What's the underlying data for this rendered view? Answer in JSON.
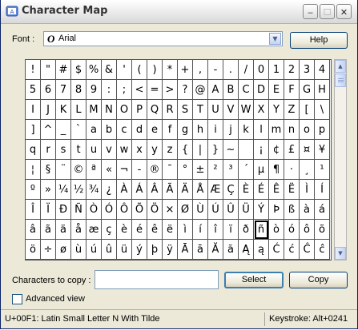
{
  "window": {
    "title": "Character Map",
    "icons": {
      "app": "character-map-icon",
      "minimize": "minimize-icon",
      "maximize": "maximize-icon",
      "close": "close-icon"
    },
    "controls": {
      "minimize": "‒",
      "maximize": "☐",
      "close": "✕"
    }
  },
  "font": {
    "label": "Font :",
    "value": "Arial",
    "type_glyph": "O",
    "dropdown_arrow": "▼"
  },
  "buttons": {
    "help": "Help",
    "select": "Select",
    "copy": "Copy"
  },
  "grid": {
    "columns": 20,
    "rows": [
      [
        "!",
        "\"",
        "#",
        "$",
        "%",
        "&",
        "'",
        "(",
        ")",
        "*",
        "+",
        ",",
        "-",
        ".",
        "/",
        "0",
        "1",
        "2",
        "3",
        "4"
      ],
      [
        "5",
        "6",
        "7",
        "8",
        "9",
        ":",
        ";",
        "<",
        "=",
        ">",
        "?",
        "@",
        "A",
        "B",
        "C",
        "D",
        "E",
        "F",
        "G",
        "H"
      ],
      [
        "I",
        "J",
        "K",
        "L",
        "M",
        "N",
        "O",
        "P",
        "Q",
        "R",
        "S",
        "T",
        "U",
        "V",
        "W",
        "X",
        "Y",
        "Z",
        "[",
        "\\"
      ],
      [
        "]",
        "^",
        "_",
        "`",
        "a",
        "b",
        "c",
        "d",
        "e",
        "f",
        "g",
        "h",
        "i",
        "j",
        "k",
        "l",
        "m",
        "n",
        "o",
        "p"
      ],
      [
        "q",
        "r",
        "s",
        "t",
        "u",
        "v",
        "w",
        "x",
        "y",
        "z",
        "{",
        "|",
        "}",
        "~",
        " ",
        "¡",
        "¢",
        "£",
        "¤",
        "¥"
      ],
      [
        "¦",
        "§",
        "¨",
        "©",
        "ª",
        "«",
        "¬",
        "-",
        "®",
        "¯",
        "°",
        "±",
        "²",
        "³",
        "´",
        "µ",
        "¶",
        "·",
        "¸",
        "¹"
      ],
      [
        "º",
        "»",
        "¼",
        "½",
        "¾",
        "¿",
        "À",
        "Á",
        "Â",
        "Ã",
        "Ä",
        "Å",
        "Æ",
        "Ç",
        "È",
        "É",
        "Ê",
        "Ë",
        "Ì",
        "Í"
      ],
      [
        "Î",
        "Ï",
        "Ð",
        "Ñ",
        "Ò",
        "Ó",
        "Ô",
        "Õ",
        "Ö",
        "×",
        "Ø",
        "Ù",
        "Ú",
        "Û",
        "Ü",
        "Ý",
        "Þ",
        "ß",
        "à",
        "á"
      ],
      [
        "â",
        "ã",
        "ä",
        "å",
        "æ",
        "ç",
        "è",
        "é",
        "ê",
        "ë",
        "ì",
        "í",
        "î",
        "ï",
        "ð",
        "ñ",
        "ò",
        "ó",
        "ô",
        "õ"
      ],
      [
        "ö",
        "÷",
        "ø",
        "ù",
        "ú",
        "û",
        "ü",
        "ý",
        "þ",
        "ÿ",
        "Ā",
        "ā",
        "Ă",
        "ă",
        "Ą",
        "ą",
        "Ć",
        "ć",
        "Ĉ",
        "ĉ"
      ]
    ],
    "selected_row": 8,
    "selected_col": 15
  },
  "scrollbar": {
    "up_arrow": "▲",
    "down_arrow": "▼"
  },
  "copy": {
    "label": "Characters to copy :",
    "value": ""
  },
  "advanced": {
    "label": "Advanced view",
    "checked": false
  },
  "status": {
    "description": "U+00F1: Latin Small Letter N With Tilde",
    "keystroke": "Keystroke: Alt+0241"
  }
}
